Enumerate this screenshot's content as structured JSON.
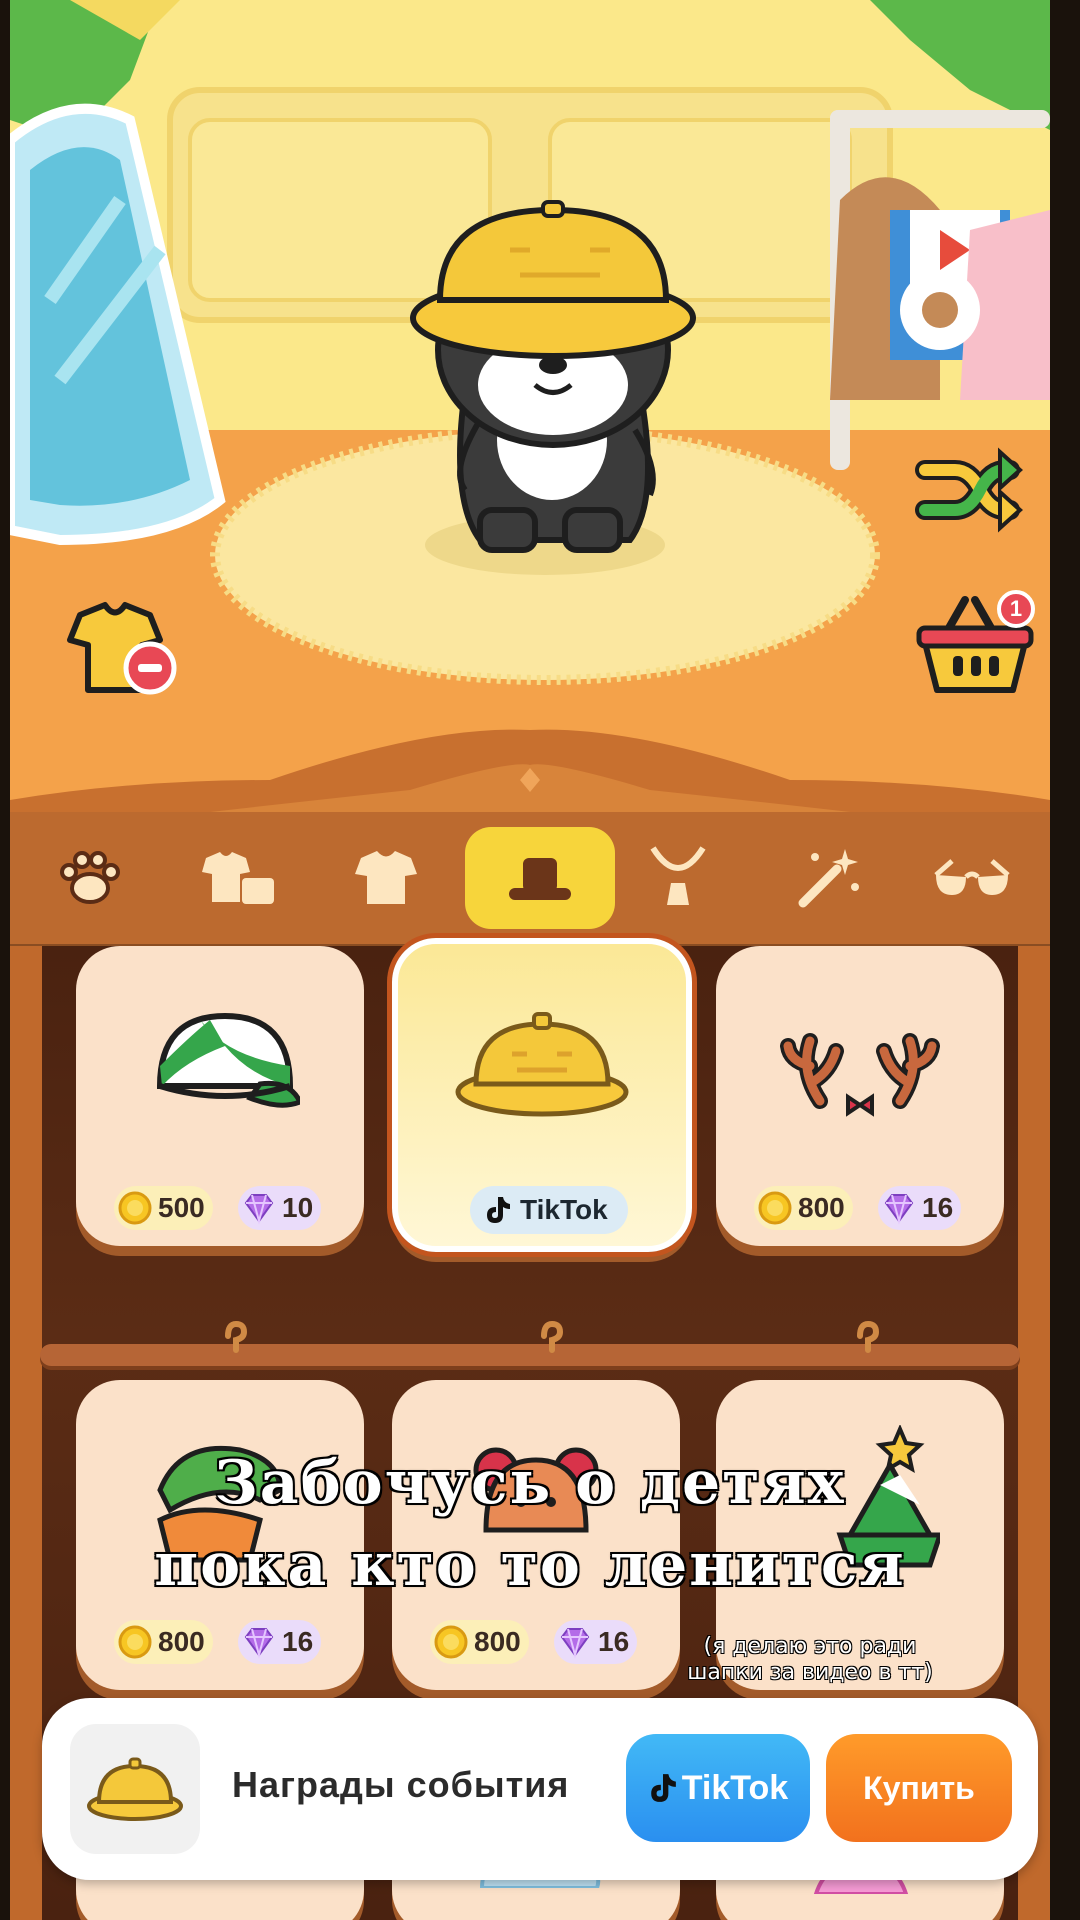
{
  "tabs": [
    {
      "icon": "paw-icon"
    },
    {
      "icon": "outfit-set-icon"
    },
    {
      "icon": "shirt-icon"
    },
    {
      "icon": "hat-icon",
      "active": true
    },
    {
      "icon": "necklace-icon"
    },
    {
      "icon": "magic-wand-icon"
    },
    {
      "icon": "glasses-icon"
    }
  ],
  "room": {
    "cart_badge": "1"
  },
  "items": [
    {
      "art": "green-cap-icon",
      "coins": "500",
      "gems": "10"
    },
    {
      "art": "yellow-helmet-icon",
      "source": "TikTok",
      "selected": true
    },
    {
      "art": "antlers-icon",
      "coins": "800",
      "gems": "16"
    },
    {
      "art": "dino-hat-icon",
      "coins": "800",
      "gems": "16"
    },
    {
      "art": "bear-hat-icon",
      "coins": "800",
      "gems": "16"
    },
    {
      "art": "tree-hat-icon"
    }
  ],
  "overlay": {
    "line1": "Забочусь о детях",
    "line2": "пока кто то ленится",
    "note_line1": "(я делаю это ради",
    "note_line2": "шапки за видео в тт)"
  },
  "bottom_bar": {
    "label": "Награды события",
    "tiktok_label": "TikTok",
    "buy_label": "Купить"
  },
  "colors": {
    "accent_tab": "#f7d53b",
    "buy_button": "#f2711d",
    "tiktok_button": "#2a8ff0"
  }
}
